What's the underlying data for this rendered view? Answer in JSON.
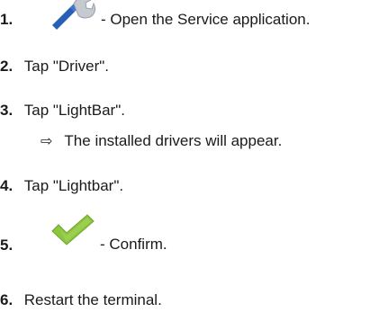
{
  "steps": [
    {
      "number": "1.",
      "text": "- Open the Service application.",
      "icon": "wrench-icon"
    },
    {
      "number": "2.",
      "text": "Tap \"Driver\"."
    },
    {
      "number": "3.",
      "text": "Tap \"LightBar\"."
    },
    {
      "number": "4.",
      "text": "Tap \"Lightbar\"."
    },
    {
      "number": "5.",
      "text": "- Confirm.",
      "icon": "checkmark-icon"
    },
    {
      "number": "6.",
      "text": "Restart the terminal."
    }
  ],
  "result": {
    "arrow": "⇨",
    "text": "The installed drivers will appear."
  },
  "colors": {
    "wrench_blue": "#2a5fb8",
    "wrench_grey": "#bfc4cb",
    "check_green": "#8cc63f"
  }
}
